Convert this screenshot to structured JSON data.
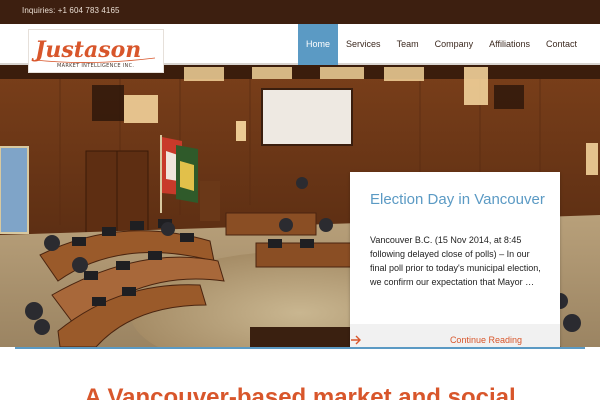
{
  "topbar": {
    "inquiries": "Inquiries: +1 604 783 4165"
  },
  "logo": {
    "name": "Justason",
    "tagline": "MARKET INTELLIGENCE INC."
  },
  "nav": {
    "items": [
      {
        "label": "Home",
        "active": true
      },
      {
        "label": "Services"
      },
      {
        "label": "Team"
      },
      {
        "label": "Company"
      },
      {
        "label": "Affiliations"
      },
      {
        "label": "Contact"
      }
    ]
  },
  "colors": {
    "accent": "#5b9ac4",
    "brand": "#d8562b",
    "topbar": "#3d1f10"
  },
  "hero": {
    "card": {
      "title": "Election Day in Vancouver",
      "excerpt": "Vancouver B.C. (15 Nov 2014, at 8:45 following delayed close of polls) – In our final poll prior to today's municipal election, we confirm our expectation that Mayor …",
      "cta": "Continue Reading",
      "cta_icon": "arrow-right-icon"
    }
  },
  "main": {
    "headline": "A Vancouver-based market and social"
  }
}
